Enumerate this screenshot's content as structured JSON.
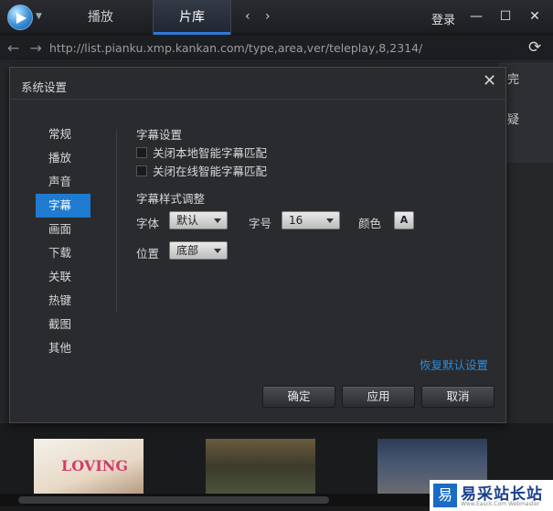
{
  "titlebar": {
    "tabs": [
      "播放",
      "片库"
    ],
    "login": "登录",
    "window": {
      "minimize": "—",
      "maximize": "☐",
      "close": "✕"
    }
  },
  "address": {
    "url": "http://list.pianku.xmp.kankan.com/type,area,ver/teleplay,8,2314/"
  },
  "background": {
    "right_chars": [
      "完",
      "疑"
    ],
    "poster1_title": "LOVING"
  },
  "dialog": {
    "title": "系统设置",
    "sidebar": [
      "常规",
      "播放",
      "声音",
      "字幕",
      "画面",
      "下载",
      "关联",
      "热键",
      "截图",
      "其他"
    ],
    "active_index": 3,
    "subtitle_settings": {
      "heading": "字幕设置",
      "options": [
        {
          "label": "关闭本地智能字幕匹配",
          "checked": false
        },
        {
          "label": "关闭在线智能字幕匹配",
          "checked": false
        }
      ]
    },
    "style": {
      "heading": "字幕样式调整",
      "font_label": "字体",
      "font_value": "默认",
      "size_label": "字号",
      "size_value": "16",
      "color_label": "颜色",
      "position_label": "位置",
      "position_value": "底部"
    },
    "restore_defaults": "恢复默认设置",
    "buttons": {
      "ok": "确定",
      "apply": "应用",
      "cancel": "取消"
    }
  },
  "watermark": {
    "logo": "易",
    "text": "易采站长站",
    "sub": "Www.Easck.Com Webmaster"
  },
  "colors": {
    "accent": "#1f7bd0",
    "link": "#2b8be0",
    "dialog_bg": "#2a2b2e"
  }
}
